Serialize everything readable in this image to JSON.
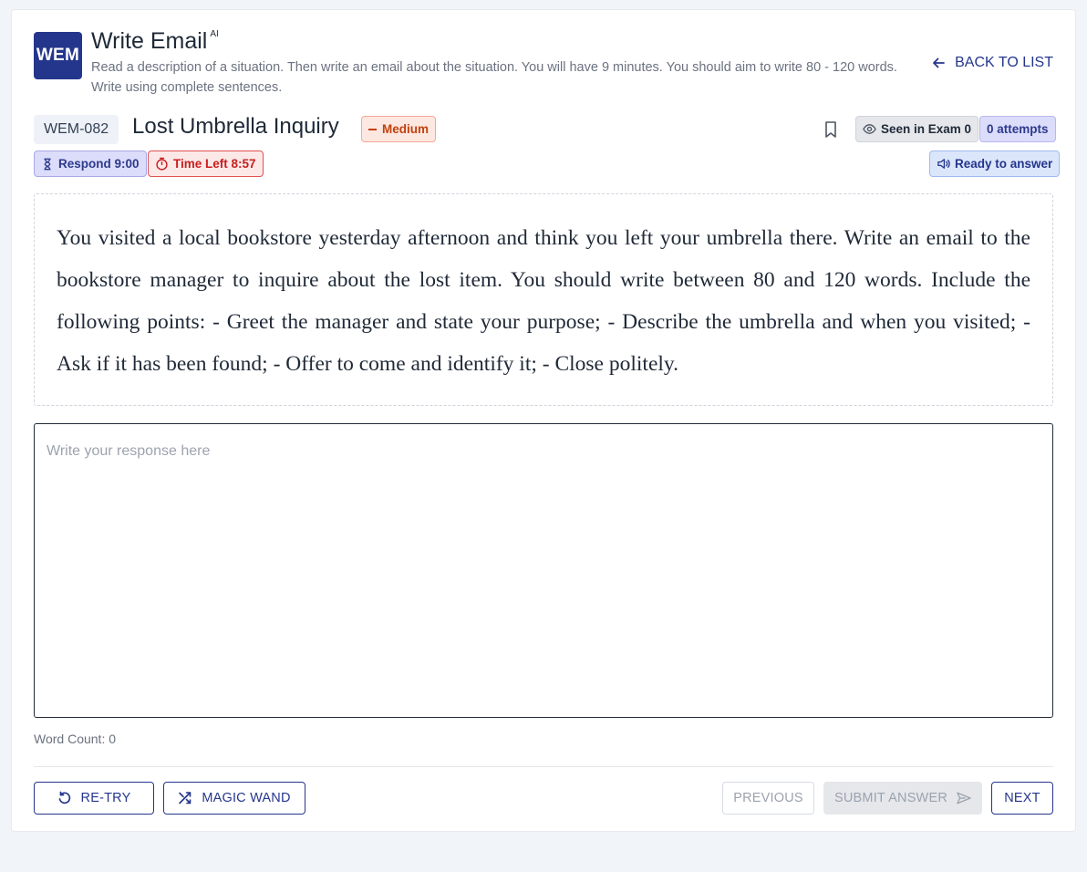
{
  "header": {
    "logo": "WEM",
    "title": "Write Email",
    "title_badge": "AI",
    "description": "Read a description of a situation. Then write an email about the situation. You will have 9 minutes. You should aim to write 80 - 120 words. Write using complete sentences.",
    "back_label": "BACK TO LIST"
  },
  "question": {
    "id": "WEM-082",
    "title": "Lost Umbrella Inquiry",
    "difficulty": "Medium",
    "seen_label": "Seen in Exam 0",
    "attempts_label": "0 attempts",
    "respond_label": "Respond 9:00",
    "time_left_label": "Time Left 8:57",
    "ready_label": "Ready to answer",
    "prompt": "You visited a local bookstore yesterday afternoon and think you left your umbrella there. Write an email to the bookstore manager to inquire about the lost item. You should write between 80 and 120 words. Include the following points: - Greet the manager and state your purpose; - Describe the umbrella and when you visited; - Ask if it has been found; - Offer to come and identify it; - Close politely."
  },
  "response": {
    "value": "",
    "placeholder": "Write your response here",
    "word_count_label": "Word Count: 0"
  },
  "actions": {
    "retry": "RE-TRY",
    "magic_wand": "MAGIC WAND",
    "previous": "PREVIOUS",
    "submit": "SUBMIT ANSWER",
    "next": "NEXT"
  },
  "colors": {
    "brand": "#24368c",
    "difficulty": "#c2410c",
    "timer": "#c81e1e"
  },
  "icons": [
    "arrow-left-icon",
    "bookmark-icon",
    "eye-icon",
    "hourglass-icon",
    "stopwatch-icon",
    "speaker-icon",
    "retry-icon",
    "shuffle-icon",
    "send-icon"
  ]
}
